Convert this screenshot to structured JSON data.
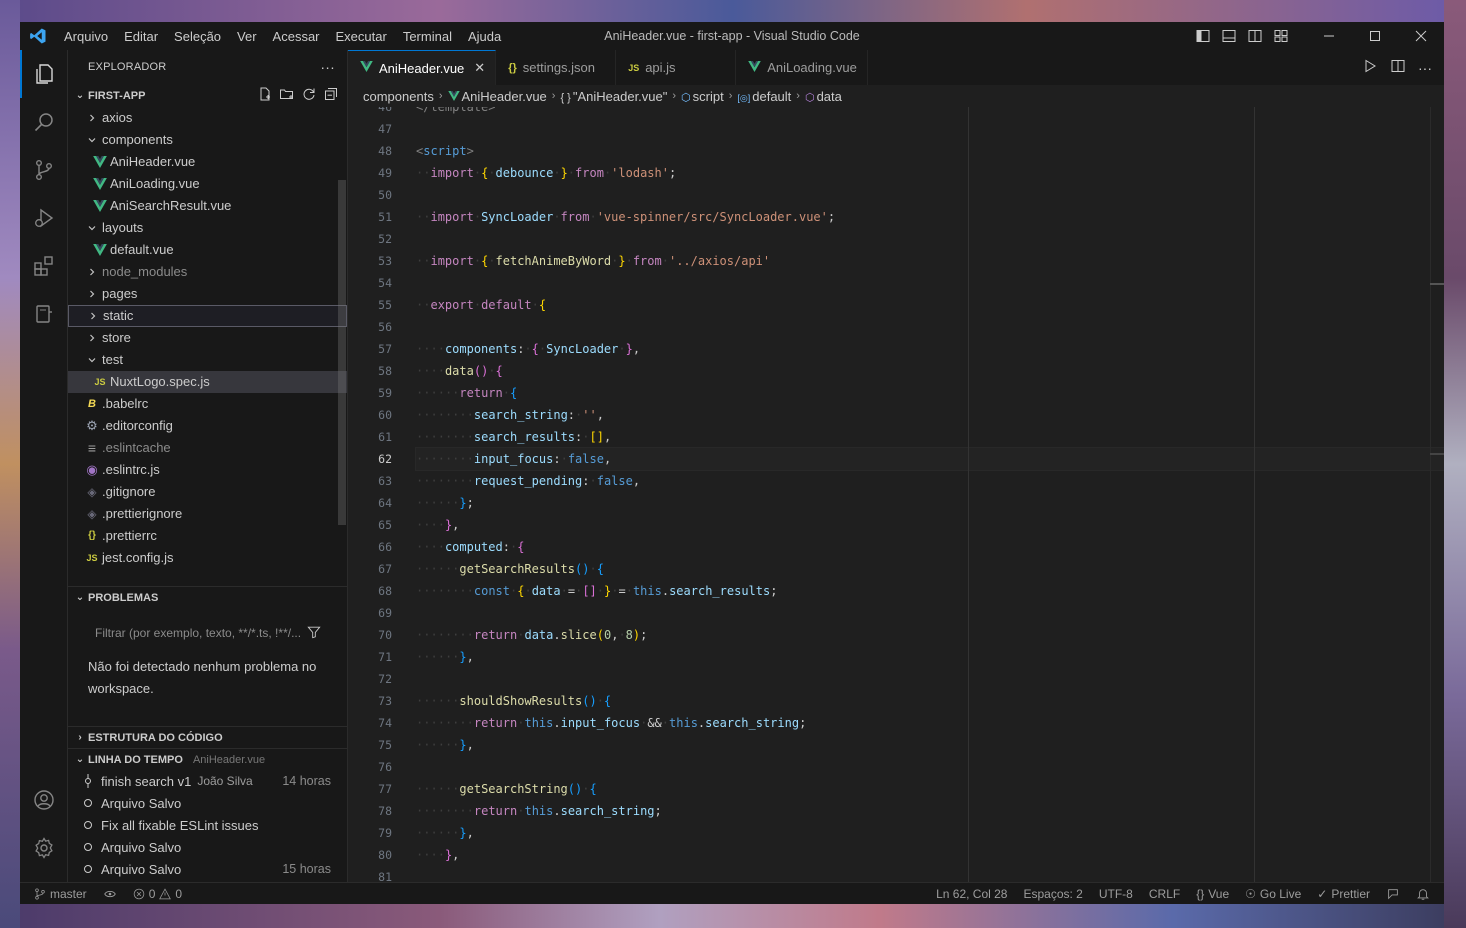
{
  "colors": {
    "accent": "#0078d4",
    "vue": "#41b883",
    "js": "#cbcb41"
  },
  "titlebar": {
    "title": "AniHeader.vue - first-app - Visual Studio Code",
    "menu": [
      "Arquivo",
      "Editar",
      "Seleção",
      "Ver",
      "Acessar",
      "Executar",
      "Terminal",
      "Ajuda"
    ]
  },
  "sidebar": {
    "header": "EXPLORADOR",
    "more": "···",
    "project": "FIRST-APP",
    "tree": [
      {
        "label": "axios",
        "type": "folder",
        "open": false,
        "depth": 1
      },
      {
        "label": "components",
        "type": "folder",
        "open": true,
        "depth": 1
      },
      {
        "label": "AniHeader.vue",
        "type": "vue",
        "depth": 2
      },
      {
        "label": "AniLoading.vue",
        "type": "vue",
        "depth": 2
      },
      {
        "label": "AniSearchResult.vue",
        "type": "vue",
        "depth": 2
      },
      {
        "label": "layouts",
        "type": "folder",
        "open": true,
        "depth": 1
      },
      {
        "label": "default.vue",
        "type": "vue",
        "depth": 2
      },
      {
        "label": "node_modules",
        "type": "folder",
        "open": false,
        "depth": 1,
        "dim": true
      },
      {
        "label": "pages",
        "type": "folder",
        "open": false,
        "depth": 1
      },
      {
        "label": "static",
        "type": "folder",
        "open": false,
        "depth": 1,
        "focused": true
      },
      {
        "label": "store",
        "type": "folder",
        "open": false,
        "depth": 1
      },
      {
        "label": "test",
        "type": "folder",
        "open": true,
        "depth": 1
      },
      {
        "label": "NuxtLogo.spec.js",
        "type": "js",
        "depth": 2,
        "selected": true
      },
      {
        "label": ".babelrc",
        "type": "babel",
        "depth": 1
      },
      {
        "label": ".editorconfig",
        "type": "gear",
        "depth": 1
      },
      {
        "label": ".eslintcache",
        "type": "lines",
        "depth": 1,
        "dim": true
      },
      {
        "label": ".eslintrc.js",
        "type": "eslint",
        "depth": 1
      },
      {
        "label": ".gitignore",
        "type": "git",
        "depth": 1
      },
      {
        "label": ".prettierignore",
        "type": "git",
        "depth": 1
      },
      {
        "label": ".prettierrc",
        "type": "json",
        "depth": 1
      },
      {
        "label": "jest.config.js",
        "type": "js",
        "depth": 1
      }
    ],
    "problems": {
      "title": "PROBLEMAS",
      "filter_placeholder": "Filtrar (por exemplo, texto, **/*.ts, !**/...",
      "message": "Não foi detectado nenhum problema no workspace."
    },
    "outline": {
      "title": "ESTRUTURA DO CÓDIGO"
    },
    "timeline": {
      "title": "LINHA DO TEMPO",
      "file": "AniHeader.vue",
      "items": [
        {
          "label": "finish search v1",
          "author": "João Silva",
          "when": "14 horas",
          "commit": true
        },
        {
          "label": "Arquivo Salvo",
          "author": "",
          "when": ""
        },
        {
          "label": "Fix all fixable ESLint issues",
          "author": "",
          "when": ""
        },
        {
          "label": "Arquivo Salvo",
          "author": "",
          "when": ""
        },
        {
          "label": "Arquivo Salvo",
          "author": "",
          "when": "15 horas"
        }
      ]
    }
  },
  "tabs": [
    {
      "label": "AniHeader.vue",
      "icon": "vue",
      "active": true
    },
    {
      "label": "settings.json",
      "icon": "json"
    },
    {
      "label": "api.js",
      "icon": "js"
    },
    {
      "label": "AniLoading.vue",
      "icon": "vue"
    }
  ],
  "breadcrumb": [
    "components",
    "AniHeader.vue",
    "\"AniHeader.vue\"",
    "script",
    "default",
    "data"
  ],
  "editor": {
    "current_line": 62,
    "first_line_partial": "</template>",
    "line_numbers": [
      47,
      48,
      49,
      50,
      51,
      52,
      53,
      54,
      55,
      56,
      57,
      58,
      59,
      60,
      61,
      62,
      63,
      64,
      65,
      66,
      67,
      68,
      69,
      70,
      71,
      72,
      73,
      74,
      75,
      76,
      77,
      78,
      79,
      80,
      81
    ]
  },
  "statusbar": {
    "branch": "master",
    "errors": "0",
    "warnings": "0",
    "position": "Ln 62, Col 28",
    "spaces": "Espaços: 2",
    "encoding": "UTF-8",
    "eol": "CRLF",
    "language": "Vue",
    "golive": "Go Live",
    "prettier": "Prettier"
  }
}
